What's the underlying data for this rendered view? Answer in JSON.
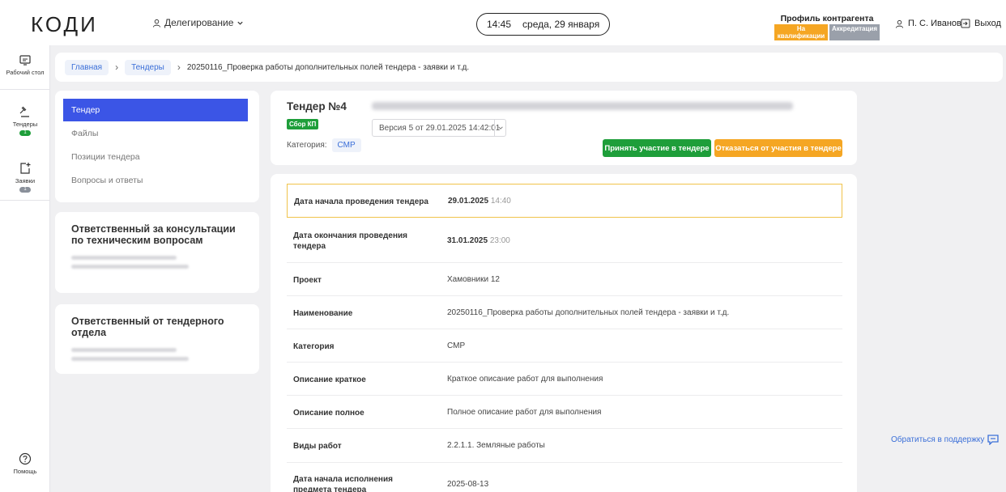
{
  "header": {
    "logo": "КОДИ",
    "delegation": "Делегирование",
    "time": "14:45",
    "date": "среда, 29 января",
    "profile_title": "Профиль контрагента",
    "badge_qualification": "На квалификации",
    "badge_accreditation": "Аккредитация",
    "user_name": "П. С. Иванов",
    "logout": "Выход"
  },
  "rail": {
    "desktop": "Рабочий стол",
    "tenders": "Тендеры",
    "tenders_count": "1",
    "requests": "Заявки",
    "requests_count": "1",
    "help": "Помощь"
  },
  "breadcrumb": {
    "home": "Главная",
    "tenders": "Тендеры",
    "current": "20250116_Проверка работы дополнительных полей тендера - заявки и т.д."
  },
  "menu": {
    "items": [
      "Тендер",
      "Файлы",
      "Позиции тендера",
      "Вопросы и ответы"
    ]
  },
  "responsible": {
    "tech_title": "Ответственный за консультации по техническим вопросам",
    "tender_title": "Ответственный от тендерного отдела"
  },
  "tender": {
    "title": "Тендер №4",
    "status": "Сбор КП",
    "version": "Версия 5 от 29.01.2025 14:42:01",
    "category_label": "Категория:",
    "category_value": "СМР",
    "accept_button": "Принять участие в тендере",
    "decline_button": "Отказаться от участия в тендере"
  },
  "details": {
    "start_label": "Дата начала проведения тендера",
    "start_date": "29.01.2025",
    "start_time": "14:40",
    "end_label": "Дата окончания проведения тендера",
    "end_date": "31.01.2025",
    "end_time": "23:00",
    "project_label": "Проект",
    "project_value": "Хамовники 12",
    "name_label": "Наименование",
    "name_value": "20250116_Проверка работы дополнительных полей тендера - заявки и т.д.",
    "category_label": "Категория",
    "category_value": "СМР",
    "short_desc_label": "Описание краткое",
    "short_desc_value": "Краткое описание работ для выполнения",
    "full_desc_label": "Описание полное",
    "full_desc_value": "Полное описание работ для выполнения",
    "work_types_label": "Виды работ",
    "work_types_value": "2.2.1.1. Земляные работы",
    "exec_start_label": "Дата начала исполнения предмета тендера",
    "exec_start_value": "2025-08-13"
  },
  "support": {
    "label": "Обратиться в поддержку"
  },
  "colors": {
    "accent_blue": "#3b55e6",
    "green": "#1e9e3a",
    "orange": "#f5a623"
  }
}
